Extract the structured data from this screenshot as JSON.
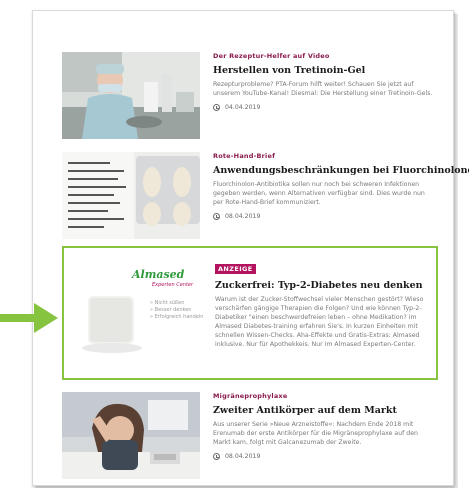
{
  "articles": [
    {
      "kicker": "Der Rezeptur-Helfer auf Video",
      "title": "Herstellen von Tretinoin-Gel",
      "body": "Rezepturprobleme? PTA-Forum hilft weiter! Schauen Sie jetzt auf unserem YouTube-Kanal! Diesmal: Die Herstellung einer Tretinoin-Gels.",
      "date": "04.04.2019",
      "image": "lab-technician-photo"
    },
    {
      "kicker": "Rote-Hand-Brief",
      "title": "Anwendungsbeschränkungen bei Fluorchinolonen",
      "body": "Fluorchinolon-Antibiotika sollen nur noch bei schweren Infektionen gegeben werden, wenn Alternativen verfügbar sind. Dies wurde nun per Rote-Hand-Brief kommuniziert.",
      "date": "08.04.2019",
      "image": "package-insert-pills-photo"
    },
    {
      "badge": "ANZEIGE",
      "title": "Zuckerfrei: Typ-2-Diabetes neu denken",
      "body": "Warum ist der Zucker-Stoffwechsel vieler Menschen gestört? Wieso verschärfen gängige Therapien die Folgen? Und wie können Typ-2-Diabetiker \"einen beschwerdefreien leben – ohne Medikation? im Almased Diabetes-training erfahren Sie's. In kurzen Einheiten mit schnellen Wissen-Checks. Aha-Effekte und Gratis-Extras: Almased inklusive. Nur für Apothekkeis. Nur im Almased Experten-Center.",
      "image": "almased-sugar-cube",
      "brand": "Almased",
      "brand_sub": "Experten Center",
      "tagline": "» Nicht süßen\n» Besser denken\n» Erfolgreich handeln"
    },
    {
      "kicker": "Migräneprophylaxe",
      "title": "Zweiter Antikörper auf dem Markt",
      "body": "Aus unserer Serie »Neue Arzneistoffe«: Nachdem Ende 2018 mit Erenumab der erste Antikörper für die Migräneprophylaxe auf den Markt kam, folgt mit Galcanezumab der Zweite.",
      "date": "08.04.2019",
      "image": "woman-headache-photo"
    }
  ],
  "colors": {
    "highlight": "#86c440",
    "kicker": "#8a1a4c",
    "badge": "#b3135f"
  }
}
